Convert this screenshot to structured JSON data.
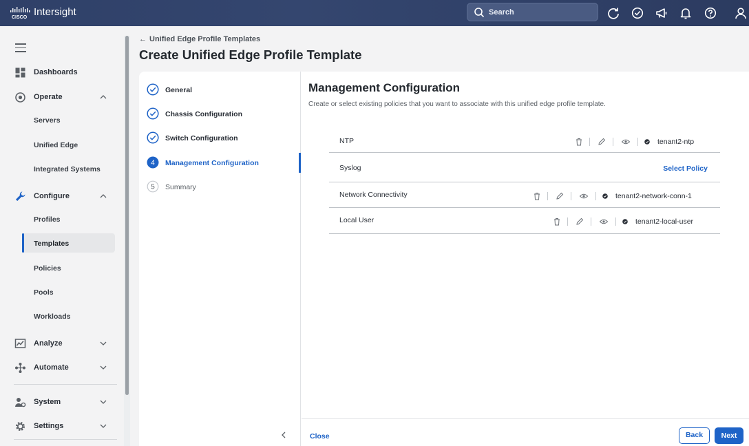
{
  "app": {
    "brand": "Intersight"
  },
  "topbar": {
    "search_label": "Search",
    "icons": [
      "refresh-icon",
      "task-check-icon",
      "megaphone-icon",
      "bell-icon",
      "help-icon",
      "user-icon"
    ]
  },
  "sidebar": {
    "items": [
      {
        "label": "Dashboards",
        "icon": "dashboard-icon"
      },
      {
        "label": "Operate",
        "icon": "operate-icon",
        "expanded": true
      },
      {
        "label": "Servers"
      },
      {
        "label": "Unified Edge"
      },
      {
        "label": "Integrated Systems"
      },
      {
        "label": "Configure",
        "icon": "wrench-icon",
        "expanded": true
      },
      {
        "label": "Profiles"
      },
      {
        "label": "Templates",
        "active": true
      },
      {
        "label": "Policies"
      },
      {
        "label": "Pools"
      },
      {
        "label": "Workloads"
      },
      {
        "label": "Analyze",
        "icon": "analyze-icon",
        "expanded": false
      },
      {
        "label": "Automate",
        "icon": "automate-icon",
        "expanded": false
      },
      {
        "label": "System",
        "icon": "system-icon",
        "expanded": false
      },
      {
        "label": "Settings",
        "icon": "gear-icon",
        "expanded": false
      }
    ]
  },
  "header": {
    "breadcrumb": "Unified Edge Profile Templates",
    "title": "Create Unified Edge Profile Template"
  },
  "steps": [
    {
      "label": "General",
      "state": "done"
    },
    {
      "label": "Chassis Configuration",
      "state": "done"
    },
    {
      "label": "Switch Configuration",
      "state": "done"
    },
    {
      "label": "Management Configuration",
      "state": "active",
      "number": "4"
    },
    {
      "label": "Summary",
      "state": "pending",
      "number": "5"
    }
  ],
  "content": {
    "title": "Management Configuration",
    "description": "Create or select existing policies that you want to associate with this unified edge profile template.",
    "policies": [
      {
        "name": "NTP",
        "value": "tenant2-ntp"
      },
      {
        "name": "Syslog",
        "action": "Select Policy"
      },
      {
        "name": "Network Connectivity",
        "value": "tenant2-network-conn-1"
      },
      {
        "name": "Local User",
        "value": "tenant2-local-user"
      }
    ]
  },
  "footer": {
    "close": "Close",
    "back": "Back",
    "next": "Next"
  },
  "colors": {
    "accent": "#1e63c7",
    "topbar": "#2f4068"
  }
}
